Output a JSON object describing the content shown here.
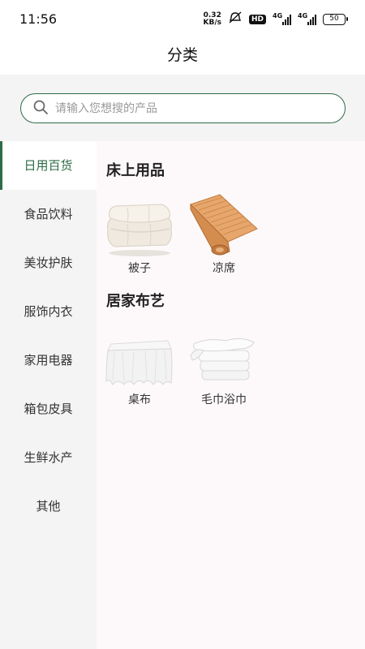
{
  "status": {
    "time": "11:56",
    "speed_value": "0.32",
    "speed_unit": "KB/s",
    "hd": "HD",
    "net1": "4G",
    "net2": "4G",
    "battery": "50"
  },
  "header": {
    "title": "分类"
  },
  "search": {
    "placeholder": "请输入您想搜的产品"
  },
  "sidebar": {
    "items": [
      {
        "label": "日用百货",
        "active": true
      },
      {
        "label": "食品饮料"
      },
      {
        "label": "美妆护肤"
      },
      {
        "label": "服饰内衣"
      },
      {
        "label": "家用电器"
      },
      {
        "label": "箱包皮具"
      },
      {
        "label": "生鲜水产"
      },
      {
        "label": "其他"
      }
    ]
  },
  "main": {
    "sections": [
      {
        "title": "床上用品",
        "items": [
          {
            "label": "被子",
            "icon": "quilt-image"
          },
          {
            "label": "凉席",
            "icon": "bamboo-mat-image"
          }
        ]
      },
      {
        "title": "居家布艺",
        "items": [
          {
            "label": "桌布",
            "icon": "tablecloth-image"
          },
          {
            "label": "毛巾浴巾",
            "icon": "towels-image"
          }
        ]
      }
    ]
  },
  "colors": {
    "accent": "#2e6b47",
    "sidebar_bg": "#f4f4f4",
    "content_bg": "#fdf9fa"
  }
}
